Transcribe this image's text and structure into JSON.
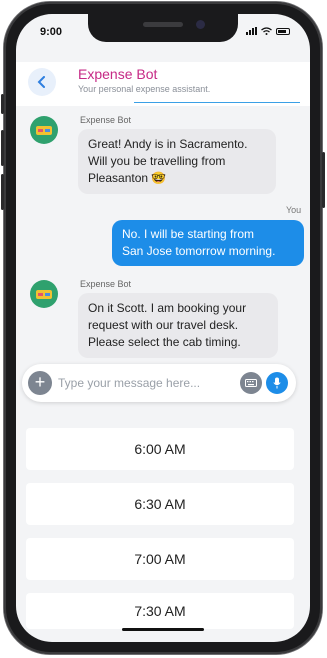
{
  "status_bar": {
    "time": "9:00"
  },
  "header": {
    "title": "Expense Bot",
    "subtitle": "Your personal expense assistant."
  },
  "messages": [
    {
      "from": "bot",
      "sender": "Expense Bot",
      "lines": [
        "Great! Andy is in Sacramento.",
        "Will you be travelling from",
        "Pleasanton 🤓"
      ]
    },
    {
      "from": "user",
      "sender": "You",
      "lines": [
        "No. I will be starting from",
        "San Jose tomorrow morning."
      ]
    },
    {
      "from": "bot",
      "sender": "Expense Bot",
      "lines": [
        "On it Scott. I am booking your",
        "request with our travel desk.",
        "Please select the cab timing."
      ]
    }
  ],
  "composer": {
    "placeholder": "Type your message here..."
  },
  "time_slots": [
    "6:00 AM",
    "6:30 AM",
    "7:00 AM",
    "7:30 AM"
  ],
  "colors": {
    "accent": "#1d8de8",
    "title": "#c62a86",
    "bot_bubble": "#e9e9ec",
    "avatar": "#2fa16e"
  }
}
